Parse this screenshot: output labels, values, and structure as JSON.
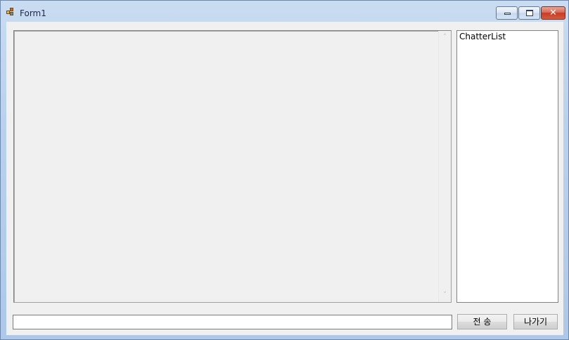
{
  "window": {
    "title": "Form1",
    "icons": {
      "app": "winforms-app-icon",
      "minimize": "minimize-icon",
      "maximize": "maximize-icon",
      "close": "close-icon"
    },
    "close_glyph": "✕"
  },
  "chat": {
    "log_text": "",
    "scroll_up_glyph": "˄",
    "scroll_down_glyph": "˅"
  },
  "chatter_list": {
    "items": [
      "ChatterList"
    ]
  },
  "composer": {
    "message_value": "",
    "send_label": "전 송",
    "exit_label": "나가기"
  }
}
